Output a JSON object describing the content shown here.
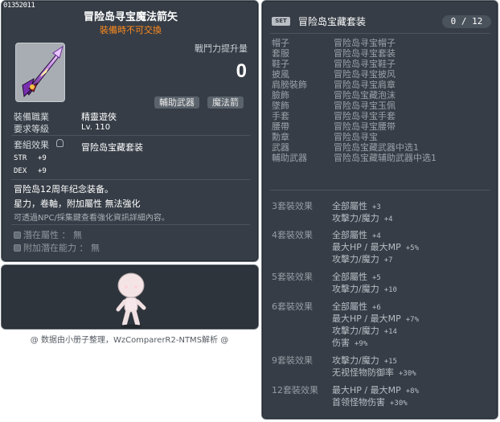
{
  "item": {
    "id": "01352011",
    "name": "冒险岛寻宝魔法箭矢",
    "restriction": "裝備時不可交換",
    "power_label": "戰鬥力提升量",
    "power_value": "0",
    "tags": [
      "輔助武器",
      "魔法箭"
    ],
    "job_label": "裝備職業",
    "job_value": "精靈遊俠",
    "level_label": "要求等級",
    "level_value": "Lv. 110",
    "set_label": "套組效果",
    "set_value": "冒险岛宝藏套装",
    "stats": [
      {
        "name": "STR",
        "value": "+9"
      },
      {
        "name": "DEX",
        "value": "+9"
      }
    ],
    "desc1": "冒险岛12周年纪念装备。",
    "desc2": "星力，卷軸，附加屬性 無法強化",
    "desc3": "可透過NPC/採集鍵查看強化資訊詳細內容。",
    "potential_label": "潛在屬性 ： 無",
    "add_potential_label": "附加潛在能力 ： 無"
  },
  "footer": "@ 数据由小册子整理，WzComparerR2-NTMS解析 @",
  "set": {
    "badge": "SET",
    "name": "冒险岛宝藏套装",
    "count": "0 / 12",
    "items": [
      {
        "slot": "帽子",
        "name": "冒险岛寻宝帽子"
      },
      {
        "slot": "套服",
        "name": "冒险岛寻宝套装"
      },
      {
        "slot": "鞋子",
        "name": "冒险岛寻宝鞋子"
      },
      {
        "slot": "披風",
        "name": "冒险岛寻宝披风"
      },
      {
        "slot": "肩膀裝飾",
        "name": "冒险岛寻宝肩章"
      },
      {
        "slot": "臉飾",
        "name": "冒险岛宝藏泡沫"
      },
      {
        "slot": "墜飾",
        "name": "冒险岛寻宝玉佩"
      },
      {
        "slot": "手套",
        "name": "冒险岛寻宝手套"
      },
      {
        "slot": "腰帶",
        "name": "冒险岛寻宝腰带"
      },
      {
        "slot": "勳章",
        "name": "冒险岛寻宝"
      },
      {
        "slot": "武器",
        "name": "冒险岛宝藏武器中选1"
      },
      {
        "slot": "輔助武器",
        "name": "冒险岛宝藏辅助武器中选1"
      }
    ],
    "effects": [
      {
        "label": "3套裝效果",
        "lines": [
          {
            "text": "全部屬性",
            "num": "+3"
          },
          {
            "text": "攻擊力/魔力",
            "num": "+4"
          }
        ]
      },
      {
        "label": "4套裝效果",
        "lines": [
          {
            "text": "全部屬性",
            "num": "+4"
          },
          {
            "text": "最大HP / 最大MP",
            "num": "+5%"
          },
          {
            "text": "攻擊力/魔力",
            "num": "+7"
          }
        ]
      },
      {
        "label": "5套裝效果",
        "lines": [
          {
            "text": "全部屬性",
            "num": "+5"
          },
          {
            "text": "攻擊力/魔力",
            "num": "+10"
          }
        ]
      },
      {
        "label": "6套裝效果",
        "lines": [
          {
            "text": "全部屬性",
            "num": "+6"
          },
          {
            "text": "最大HP / 最大MP",
            "num": "+7%"
          },
          {
            "text": "攻擊力/魔力",
            "num": "+14"
          },
          {
            "text": "伤害",
            "num": "+9%"
          }
        ]
      },
      {
        "label": "9套裝效果",
        "lines": [
          {
            "text": "攻擊力/魔力",
            "num": "+15"
          },
          {
            "text": "无视怪物防御率",
            "num": "+30%"
          }
        ]
      },
      {
        "label": "12套裝效果",
        "lines": [
          {
            "text": "最大HP / 最大MP",
            "num": "+8%"
          },
          {
            "text": "首领怪物伤害",
            "num": "+30%"
          }
        ]
      }
    ]
  }
}
